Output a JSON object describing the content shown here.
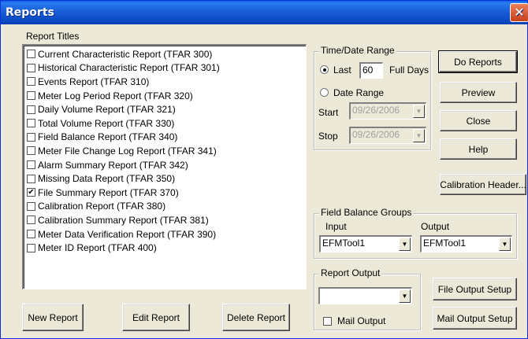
{
  "window": {
    "title": "Reports",
    "close_glyph": "✕"
  },
  "report_titles": {
    "label": "Report Titles",
    "items": [
      {
        "label": "Current Characteristic Report (TFAR 300)",
        "checked": false
      },
      {
        "label": "Historical Characteristic Report (TFAR 301)",
        "checked": false
      },
      {
        "label": "Events Report (TFAR 310)",
        "checked": false
      },
      {
        "label": "Meter Log Period Report (TFAR 320)",
        "checked": false
      },
      {
        "label": "Daily Volume Report (TFAR 321)",
        "checked": false
      },
      {
        "label": "Total Volume Report (TFAR 330)",
        "checked": false
      },
      {
        "label": "Field Balance Report (TFAR 340)",
        "checked": false
      },
      {
        "label": "Meter File Change Log Report (TFAR 341)",
        "checked": false
      },
      {
        "label": "Alarm Summary Report (TFAR 342)",
        "checked": false
      },
      {
        "label": "Missing Data Report (TFAR 350)",
        "checked": false
      },
      {
        "label": "File Summary Report (TFAR 370)",
        "checked": true
      },
      {
        "label": "Calibration Report (TFAR 380)",
        "checked": false
      },
      {
        "label": "Calibration Summary Report (TFAR 381)",
        "checked": false
      },
      {
        "label": "Meter Data Verification Report (TFAR 390)",
        "checked": false
      },
      {
        "label": "Meter ID Report (TFAR 400)",
        "checked": false
      }
    ]
  },
  "bottom_buttons": {
    "new_report": "New Report",
    "edit_report": "Edit Report",
    "delete_report": "Delete Report"
  },
  "time_date": {
    "group_label": "Time/Date Range",
    "last_label": "Last",
    "last_value": "60",
    "full_days_label": "Full Days",
    "date_range_label": "Date Range",
    "start_label": "Start",
    "start_value": "09/26/2006",
    "stop_label": "Stop",
    "stop_value": "09/26/2006",
    "selected": "last"
  },
  "side_buttons": {
    "do_reports": "Do Reports",
    "preview": "Preview",
    "close": "Close",
    "help": "Help",
    "calibration_header": "Calibration Header..."
  },
  "field_balance": {
    "group_label": "Field Balance Groups",
    "input_label": "Input",
    "input_value": "EFMTool1",
    "output_label": "Output",
    "output_value": "EFMTool1"
  },
  "report_output": {
    "group_label": "Report Output",
    "select_value": "",
    "mail_output_label": "Mail Output",
    "mail_output_checked": false,
    "file_output_setup": "File Output Setup",
    "mail_output_setup": "Mail Output Setup"
  },
  "icons": {
    "dropdown_arrow": "▼",
    "check_mark": "✔"
  }
}
